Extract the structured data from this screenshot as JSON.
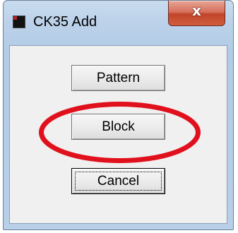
{
  "window": {
    "title": "CK35 Add",
    "close_glyph": "x",
    "icon": "app-icon"
  },
  "buttons": {
    "pattern_label": "Pattern",
    "block_label": "Block",
    "cancel_label": "Cancel"
  },
  "annotation": {
    "shape": "ellipse",
    "target": "block-button",
    "color": "#e0101c"
  }
}
